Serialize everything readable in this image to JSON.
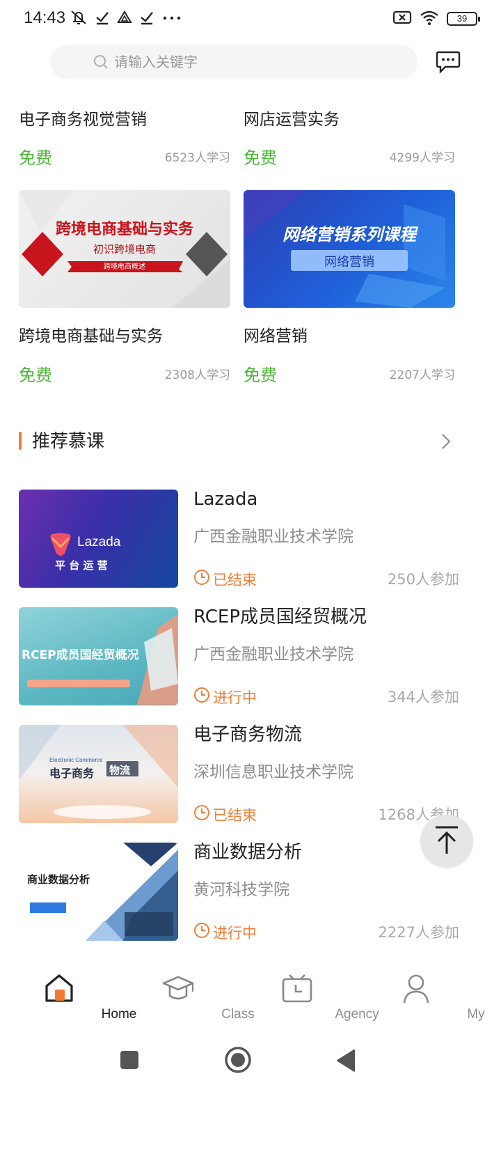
{
  "status_bar": {
    "time": "14:43",
    "battery": "39"
  },
  "search": {
    "placeholder": "请输入关键字"
  },
  "free_courses": [
    {
      "title": "电子商务视觉营销",
      "price": "免费",
      "learners": "6523人学习"
    },
    {
      "title": "网店运营实务",
      "price": "免费",
      "learners": "4299人学习"
    },
    {
      "title": "跨境电商基础与实务",
      "price": "免费",
      "learners": "2308人学习",
      "thumb": {
        "headline": "跨境电商基础与实务",
        "sub": "初识跨境电商",
        "ribbon": "跨境电商概述"
      }
    },
    {
      "title": "网络营销",
      "price": "免费",
      "learners": "2207人学习",
      "thumb": {
        "headline": "网络营销系列课程",
        "sub": "网络营销"
      }
    }
  ],
  "section": {
    "title": "推荐慕课"
  },
  "mooc_list": [
    {
      "title": "Lazada",
      "school": "广西金融职业技术学院",
      "status": "已结束",
      "count": "250人参加",
      "thumb": {
        "brand": "Lazada",
        "sub": "平 台 运 营"
      }
    },
    {
      "title": "RCEP成员国经贸概况",
      "school": "广西金融职业技术学院",
      "status": "进行中",
      "count": "344人参加",
      "thumb": {
        "headline": "RCEP成员国经贸概况"
      }
    },
    {
      "title": "电子商务物流",
      "school": "深圳信息职业技术学院",
      "status": "已结束",
      "count": "1268人参加",
      "thumb": {
        "eng": "Electronic Commerce",
        "left": "电子商务",
        "right": "物流"
      }
    },
    {
      "title": "商业数据分析",
      "school": "黄河科技学院",
      "status": "进行中",
      "count": "2227人参加",
      "thumb": {
        "headline": "商业数据分析"
      }
    }
  ],
  "bottom_nav": [
    {
      "label": "Home",
      "active": true
    },
    {
      "label": "Class",
      "active": false
    },
    {
      "label": "Agency",
      "active": false
    },
    {
      "label": "My",
      "active": false
    }
  ],
  "colors": {
    "accent_orange": "#f37a35",
    "free_green": "#4ab835",
    "status_orange": "#ee7e38"
  }
}
